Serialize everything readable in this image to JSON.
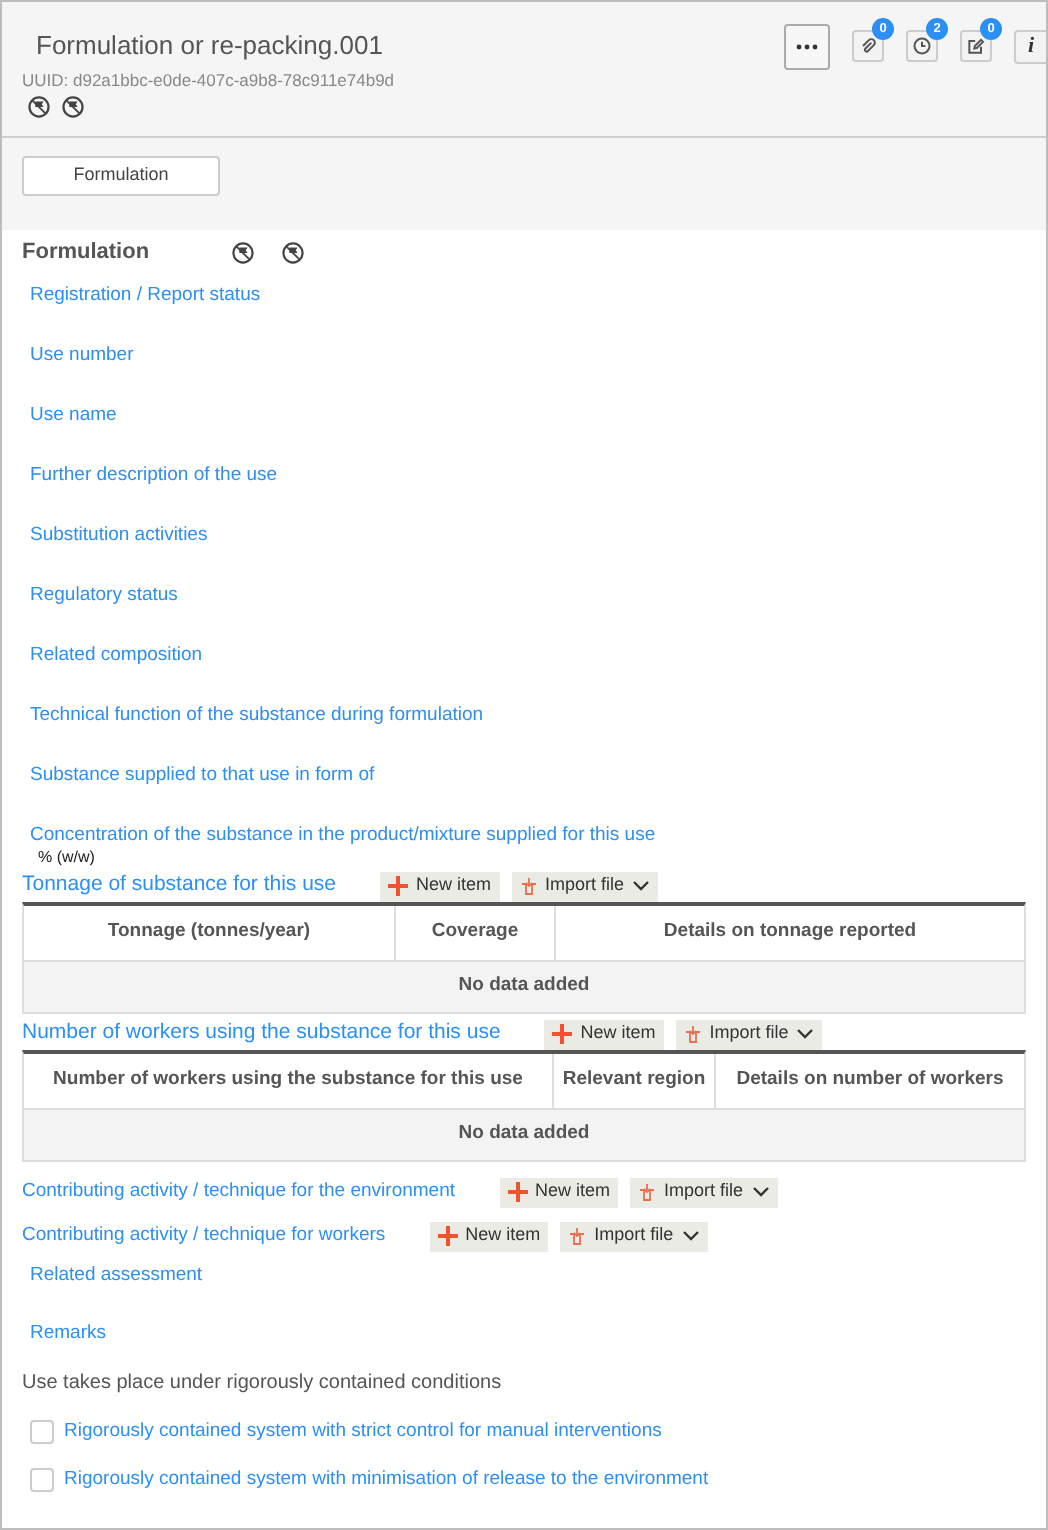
{
  "header": {
    "title": "Formulation or re-packing.001",
    "uuid": "UUID: d92a1bbc-e0de-407c-a9b8-78c911e74b9d",
    "badges": [
      {
        "kind": "attachment",
        "count": "0"
      },
      {
        "kind": "history",
        "count": "2"
      },
      {
        "kind": "note",
        "count": "0"
      }
    ],
    "info": "i"
  },
  "tabs": [
    {
      "label": "Formulation",
      "selected": true
    }
  ],
  "section": {
    "title": "Formulation",
    "fields": [
      {
        "label": "Registration / Report status"
      },
      {
        "label": "Use number"
      },
      {
        "label": "Use name"
      },
      {
        "label": "Further description of the use"
      },
      {
        "label": "Substitution activities"
      },
      {
        "label": "Regulatory status"
      },
      {
        "label": "Related composition"
      },
      {
        "label": "Technical function of the substance during formulation"
      },
      {
        "label": "Substance supplied to that use in form of"
      },
      {
        "label": "Concentration of the substance in the product/mixture supplied for this use",
        "value": "% (w/w)"
      }
    ],
    "tables": [
      {
        "title": "Tonnage of substance for this use",
        "new_item": "New item",
        "import": "Import file",
        "columns": [
          "Tonnage (tonnes/year)",
          "Coverage",
          "Details on tonnage reported"
        ],
        "empty": "No data added"
      },
      {
        "title": "Number of workers using the substance for this use",
        "new_item": "New item",
        "import": "Import file",
        "columns": [
          "Number of workers using the substance for this use",
          "Relevant region",
          "Details on number of workers"
        ],
        "empty": "No data added"
      }
    ],
    "repeatables": [
      {
        "title": "Contributing activity / technique for the environment",
        "new_item": "New item",
        "import": "Import file"
      },
      {
        "title": "Contributing activity / technique for workers",
        "new_item": "New item",
        "import": "Import file"
      }
    ],
    "more_fields": [
      {
        "label": "Related assessment"
      },
      {
        "label": "Remarks"
      }
    ],
    "question": "Use takes place under rigorously contained conditions",
    "checkboxes": [
      {
        "label": "Rigorously contained system with strict control for manual interventions",
        "checked": false
      },
      {
        "label": "Rigorously contained system with minimisation of release to the environment",
        "checked": false
      }
    ]
  }
}
